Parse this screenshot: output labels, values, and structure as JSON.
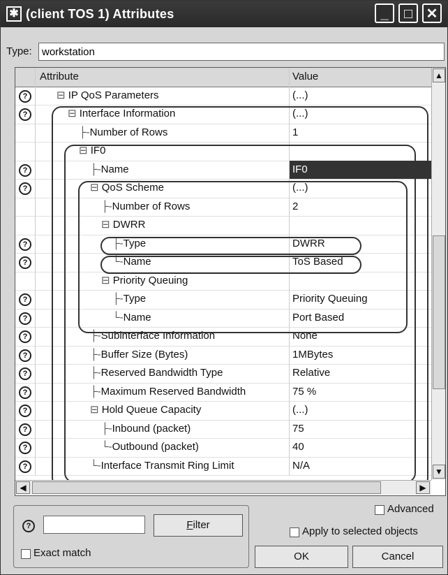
{
  "window": {
    "title": "(client TOS 1) Attributes",
    "icon": "asterisk-icon",
    "controls": [
      "minimize-icon",
      "maximize-icon",
      "close-icon"
    ]
  },
  "type_field": {
    "label": "Type:",
    "value": "workstation"
  },
  "table": {
    "headers": {
      "attribute": "Attribute",
      "value": "Value"
    },
    "rows": [
      {
        "help": true,
        "indent": 1,
        "expander": "⊟",
        "attr": "IP QoS Parameters",
        "value": "(...)"
      },
      {
        "help": true,
        "indent": 2,
        "expander": "⊟",
        "attr": "Interface Information",
        "value": "(...)"
      },
      {
        "help": false,
        "indent": 3,
        "branch": "├",
        "attr": "Number of Rows",
        "value": "1"
      },
      {
        "help": false,
        "indent": 3,
        "expander": "⊟",
        "attr": "IF0",
        "value": ""
      },
      {
        "help": true,
        "indent": 4,
        "branch": "├",
        "attr": "Name",
        "value": "IF0",
        "selected": true
      },
      {
        "help": true,
        "indent": 4,
        "expander": "⊟",
        "attr": "QoS Scheme",
        "value": "(...)"
      },
      {
        "help": false,
        "indent": 5,
        "branch": "├",
        "attr": "Number of Rows",
        "value": "2"
      },
      {
        "help": false,
        "indent": 5,
        "expander": "⊟",
        "attr": "DWRR",
        "value": ""
      },
      {
        "help": true,
        "indent": 6,
        "branch": "├",
        "attr": "Type",
        "value": "DWRR"
      },
      {
        "help": true,
        "indent": 6,
        "branch": "└",
        "attr": "Name",
        "value": "ToS Based"
      },
      {
        "help": false,
        "indent": 5,
        "expander": "⊟",
        "attr": "Priority Queuing",
        "value": ""
      },
      {
        "help": true,
        "indent": 6,
        "branch": "├",
        "attr": "Type",
        "value": "Priority Queuing"
      },
      {
        "help": true,
        "indent": 6,
        "branch": "└",
        "attr": "Name",
        "value": "Port Based"
      },
      {
        "help": true,
        "indent": 4,
        "branch": "├",
        "attr": "Subinterface Information",
        "value": "None"
      },
      {
        "help": true,
        "indent": 4,
        "branch": "├",
        "attr": "Buffer Size (Bytes)",
        "value": "1MBytes"
      },
      {
        "help": true,
        "indent": 4,
        "branch": "├",
        "attr": "Reserved Bandwidth Type",
        "value": "Relative"
      },
      {
        "help": true,
        "indent": 4,
        "branch": "├",
        "attr": "Maximum Reserved Bandwidth",
        "value": "75 %"
      },
      {
        "help": true,
        "indent": 4,
        "expander": "⊟",
        "attr": "Hold Queue Capacity",
        "value": "(...)"
      },
      {
        "help": true,
        "indent": 5,
        "branch": "├",
        "attr": "Inbound (packet)",
        "value": "75"
      },
      {
        "help": true,
        "indent": 5,
        "branch": "└",
        "attr": "Outbound (packet)",
        "value": "40"
      },
      {
        "help": true,
        "indent": 4,
        "branch": "└",
        "attr": "Interface Transmit Ring Limit",
        "value": "N/A"
      }
    ]
  },
  "filter": {
    "help_icon": "help-icon",
    "input_value": "",
    "button_label": "Filter",
    "button_mnemonic": "F",
    "exact_match_label": "Exact match",
    "exact_match_checked": false
  },
  "options": {
    "advanced_label": "Advanced",
    "advanced_checked": false,
    "apply_label": "Apply to selected objects",
    "apply_checked": false
  },
  "buttons": {
    "ok": "OK",
    "cancel": "Cancel"
  }
}
